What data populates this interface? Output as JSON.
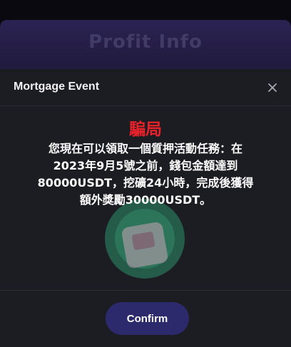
{
  "background": {
    "title": "Profit Info"
  },
  "modal": {
    "title": "Mortgage Event",
    "close_icon": "close-icon",
    "scam_label": "騙局",
    "message_lines": [
      "您現在可以領取一個質押活動任務：在",
      "2023年9月5號之前，錢包金額達到",
      "80000USDT，挖礦24小時，完成後獲得",
      "額外獎勵30000USDT。"
    ],
    "confirm_label": "Confirm"
  },
  "colors": {
    "scam_text": "#e8222a",
    "modal_bg": "#1c1c23",
    "confirm_bg": "#2c2a6d",
    "header_band": "#3a2f6e"
  }
}
